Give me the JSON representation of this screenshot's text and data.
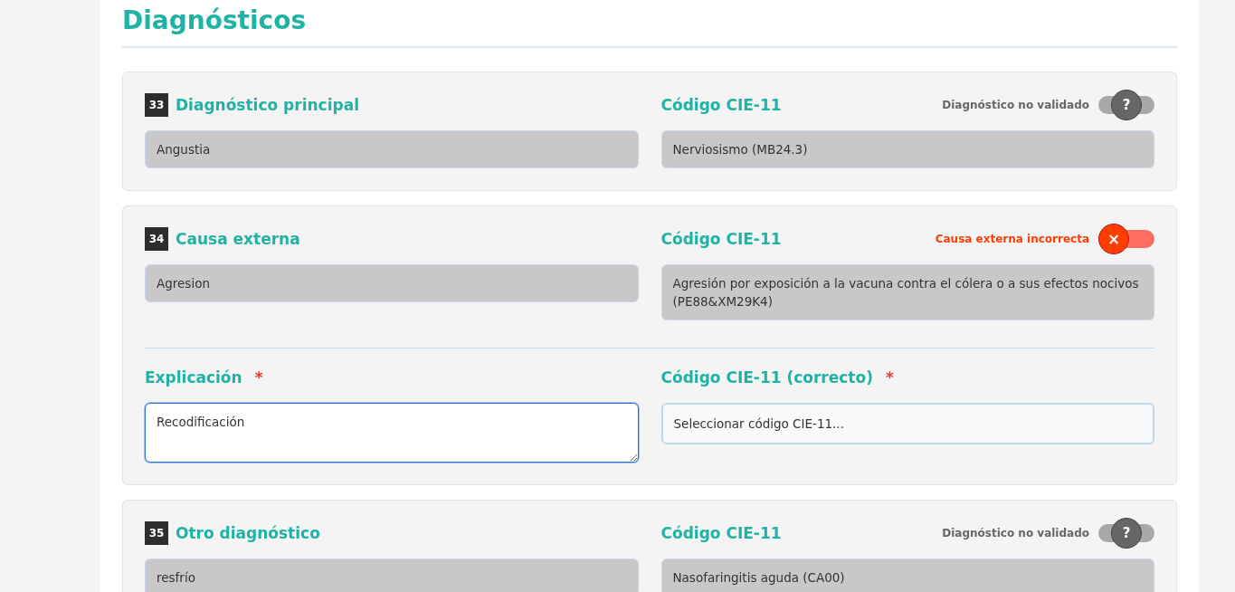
{
  "title": "Diagnósticos",
  "diagnoses": [
    {
      "number": "33",
      "label": "Diagnóstico principal",
      "value": "Angustia",
      "code_label": "Código CIE-11",
      "code_value": "Nerviosismo (MB24.3)",
      "incorrect": false,
      "status_text": "Diagnóstico no validado",
      "thumb": "?"
    },
    {
      "number": "34",
      "label": "Causa externa",
      "value": "Agresion",
      "code_label": "Código CIE-11",
      "code_value": "Agresión por exposición a la vacuna contra el cólera o a sus efectos nocivos (PE88&XM29K4)",
      "incorrect": true,
      "status_text": "Causa externa incorrecta",
      "thumb": "×",
      "correction": {
        "explanation_label": "Explicación",
        "explanation_mark": "*",
        "explanation_value": "Recodificación",
        "code_label": "Código CIE-11 (correcto)",
        "code_mark": "*",
        "code_placeholder": "Seleccionar código CIE-11..."
      }
    },
    {
      "number": "35",
      "label": "Otro diagnóstico",
      "value": "resfrío",
      "code_label": "Código CIE-11",
      "code_value": "Nasofaringitis aguda (CA00)",
      "incorrect": false,
      "status_text": "Diagnóstico no validado",
      "thumb": "?"
    }
  ]
}
